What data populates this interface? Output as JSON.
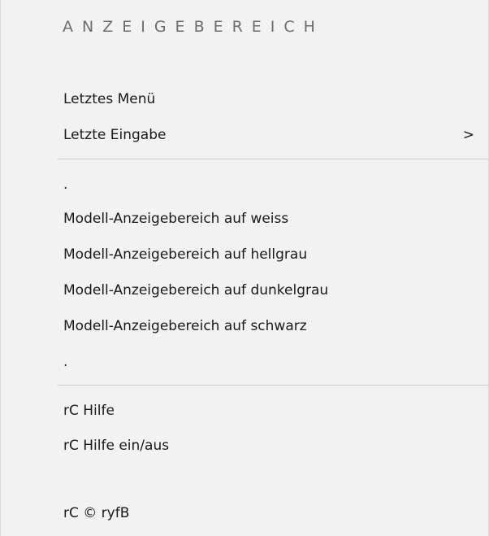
{
  "menu": {
    "header": "ANZEIGEBEREICH",
    "items": [
      {
        "label": "Letztes Menü"
      },
      {
        "label": "Letzte Eingabe",
        "submenu_indicator": ">"
      },
      {
        "label": "."
      },
      {
        "label": "Modell-Anzeigebereich auf weiss"
      },
      {
        "label": "Modell-Anzeigebereich auf hellgrau"
      },
      {
        "label": "Modell-Anzeigebereich auf dunkelgrau"
      },
      {
        "label": "Modell-Anzeigebereich auf schwarz"
      },
      {
        "label": "."
      },
      {
        "label": "rC Hilfe"
      },
      {
        "label": "rC Hilfe ein/aus"
      },
      {
        "label": "rC © ryfB"
      }
    ]
  }
}
